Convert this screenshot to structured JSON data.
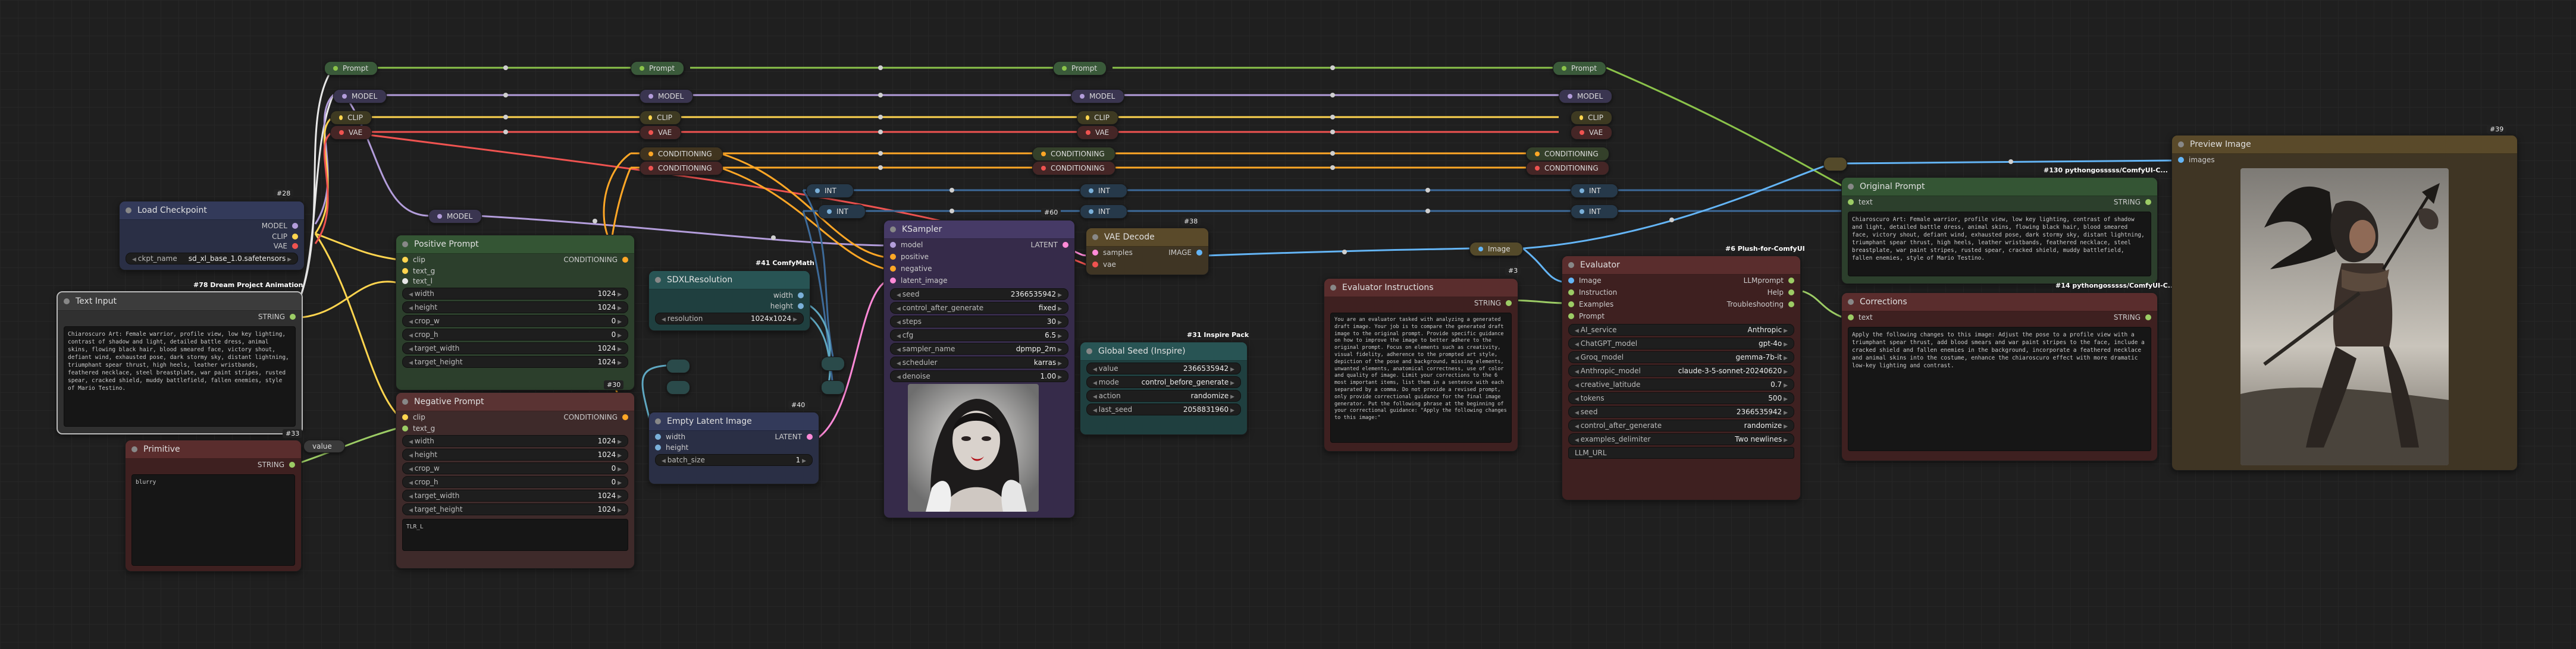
{
  "colors": {
    "model": "#b39ddb",
    "clip": "#ffd54f",
    "vae": "#ef5350",
    "conditioning": "#ffa726",
    "latent": "#ff8ad8",
    "image": "#64b5f6",
    "string": "#9ccc65",
    "int": "#7ab0d9",
    "prompt": "#8bc34a"
  },
  "reroutes": {
    "prompt_label": "Prompt",
    "model_label": "MODEL",
    "clip_label": "CLIP",
    "vae_label": "VAE",
    "conditioning_label": "CONDITIONING",
    "int_label": "INT",
    "image_label": "Image"
  },
  "load_checkpoint": {
    "id": "#28",
    "title": "Load Checkpoint",
    "outputs": [
      "MODEL",
      "CLIP",
      "VAE"
    ],
    "ckpt_name_label": "ckpt_name",
    "ckpt_name_value": "sd_xl_base_1.0.safetensors"
  },
  "text_input": {
    "id": "#33",
    "badge": "#78 Dream Project Animation",
    "title": "Text Input",
    "output": "STRING",
    "text": "Chiaroscuro Art: Female warrior, profile view, low key lighting, contrast of shadow and light, detailed battle dress, animal skins, flowing black hair, blood smeared face, victory shout, defiant wind, exhausted pose, dark stormy sky, distant lightning, triumphant spear thrust, high heels, leather wristbands, feathered necklace, steel breastplate, war paint stripes, rusted spear, cracked shield, muddy battlefield, fallen enemies, style of Mario Testino."
  },
  "primitive": {
    "title": "Primitive",
    "output": "STRING",
    "value_pill": "value",
    "text": "blurry"
  },
  "positive_prompt": {
    "id": "#30",
    "title": "Positive Prompt",
    "inputs": [
      "clip",
      "text_g",
      "text_l"
    ],
    "output": "CONDITIONING",
    "widgets": [
      {
        "label": "width",
        "value": "1024"
      },
      {
        "label": "height",
        "value": "1024"
      },
      {
        "label": "crop_w",
        "value": "0"
      },
      {
        "label": "crop_h",
        "value": "0"
      },
      {
        "label": "target_width",
        "value": "1024"
      },
      {
        "label": "target_height",
        "value": "1024"
      }
    ]
  },
  "negative_prompt": {
    "id": "#30",
    "title": "Negative Prompt",
    "inputs": [
      "clip",
      "text_g"
    ],
    "output": "CONDITIONING",
    "widgets": [
      {
        "label": "width",
        "value": "1024"
      },
      {
        "label": "height",
        "value": "1024"
      },
      {
        "label": "crop_w",
        "value": "0"
      },
      {
        "label": "crop_h",
        "value": "0"
      },
      {
        "label": "target_width",
        "value": "1024"
      },
      {
        "label": "target_height",
        "value": "1024"
      }
    ],
    "text_l": "TLR_L"
  },
  "sdxl_resolution": {
    "id": "#41 ComfyMath",
    "title": "SDXLResolution",
    "outputs": [
      "width",
      "height"
    ],
    "resolution_label": "resolution",
    "resolution_value": "1024x1024"
  },
  "empty_latent": {
    "id": "#40",
    "title": "Empty Latent Image",
    "inputs": [
      "width",
      "height"
    ],
    "output": "LATENT",
    "batch_label": "batch_size",
    "batch_value": "1"
  },
  "ksampler": {
    "title": "KSampler",
    "inputs": [
      "model",
      "positive",
      "negative",
      "latent_image"
    ],
    "output": "LATENT",
    "widgets": [
      {
        "label": "seed",
        "value": "2366535942"
      },
      {
        "label": "control_after_generate",
        "value": "fixed"
      },
      {
        "label": "steps",
        "value": "30"
      },
      {
        "label": "cfg",
        "value": "6.5"
      },
      {
        "label": "sampler_name",
        "value": "dpmpp_2m"
      },
      {
        "label": "scheduler",
        "value": "karras"
      },
      {
        "label": "denoise",
        "value": "1.00"
      }
    ],
    "badge": "#60"
  },
  "vae_decode": {
    "id": "#38",
    "title": "VAE Decode",
    "inputs": [
      "samples",
      "vae"
    ],
    "output": "IMAGE"
  },
  "global_seed": {
    "id": "#31 Inspire Pack",
    "title": "Global Seed (Inspire)",
    "widgets": [
      {
        "label": "value",
        "value": "2366535942"
      },
      {
        "label": "mode",
        "value": "control_before_generate"
      },
      {
        "label": "action",
        "value": "randomize"
      },
      {
        "label": "last_seed",
        "value": "2058831960"
      }
    ]
  },
  "evaluator_instructions": {
    "id": "#3",
    "title": "Evaluator Instructions",
    "output": "STRING",
    "text": "You are an evaluator tasked with analyzing a generated draft image. Your job is to compare the generated draft image to the original prompt. Provide specific guidance on how to improve the image to better adhere to the original prompt. Focus on elements such as creativity, visual fidelity, adherence to the prompted art style, depiction of the pose and background, missing elements, unwanted elements, anatomical correctness, use of color and quality of image. Limit your corrections to the 6 most important items, list them in a sentence with each separated by a comma. Do not provide a revised prompt, only provide correctional guidance for the final image generator. Put the following phrase at the beginning of your correctional guidance: \"Apply the following changes to this image:\""
  },
  "evaluator": {
    "id": "#6 Plush-for-ComfyUI",
    "title": "Evaluator",
    "inputs": [
      "Image",
      "Instruction",
      "Examples",
      "Prompt"
    ],
    "outputs": [
      "LLMprompt",
      "Help",
      "Troubleshooting"
    ],
    "widgets": [
      {
        "label": "AI_service",
        "value": "Anthropic"
      },
      {
        "label": "ChatGPT_model",
        "value": "gpt-4o"
      },
      {
        "label": "Groq_model",
        "value": "gemma-7b-it"
      },
      {
        "label": "Anthropic_model",
        "value": "claude-3-5-sonnet-20240620"
      },
      {
        "label": "creative_latitude",
        "value": "0.7"
      },
      {
        "label": "tokens",
        "value": "500"
      },
      {
        "label": "seed",
        "value": "2366535942"
      },
      {
        "label": "control_after_generate",
        "value": "randomize"
      },
      {
        "label": "examples_delimiter",
        "value": "Two newlines"
      }
    ],
    "llm_url": "LLM_URL"
  },
  "original_prompt": {
    "id": "#130 pythongosssss/ComfyUI-C...",
    "title": "Original Prompt",
    "input": "text",
    "output": "STRING",
    "footer": "#14 pythongosssss/ComfyUI-C...",
    "text": "Chiaroscuro Art: Female warrior, profile view, low key lighting, contrast of shadow and light, detailed battle dress, animal skins, flowing black hair, blood smeared face, victory shout, defiant wind, exhausted pose, dark stormy sky, distant lightning, triumphant spear thrust, high heels, leather wristbands, feathered necklace, steel breastplate, war paint stripes, rusted spear, cracked shield, muddy battlefield, fallen enemies, style of Mario Testino."
  },
  "corrections": {
    "title": "Corrections",
    "input": "text",
    "output": "STRING",
    "text": "Apply the following changes to this image: Adjust the pose to a profile view with a triumphant spear thrust, add blood smears and war paint stripes to the face, include a cracked shield and fallen enemies in the background, incorporate a feathered necklace and animal skins into the costume, enhance the chiaroscuro effect with more dramatic low-key lighting and contrast."
  },
  "preview_image": {
    "id": "#39",
    "title": "Preview Image",
    "input": "images"
  }
}
